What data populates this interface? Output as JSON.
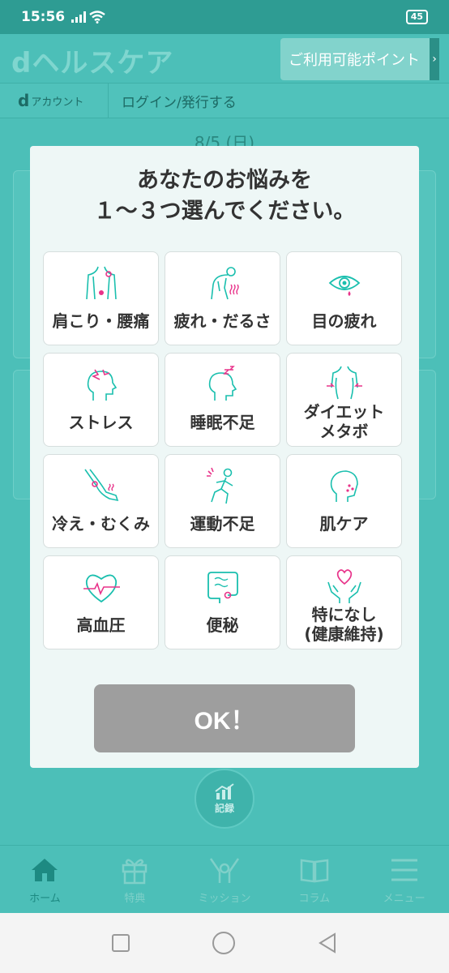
{
  "status": {
    "time": "15:56",
    "battery": "45"
  },
  "header": {
    "logo": "dヘルスケア",
    "points_button": "ご利用可能ポイント"
  },
  "account": {
    "label_prefix": "d",
    "label": "アカウント",
    "login": "ログイン/発行する"
  },
  "background": {
    "date": "8/5 (日)"
  },
  "modal": {
    "title_line1": "あなたのお悩みを",
    "title_line2": "１～３つ選んでください。",
    "options": [
      {
        "label": "肩こり・腰痛",
        "icon": "shoulder-back-pain-icon"
      },
      {
        "label": "疲れ・だるさ",
        "icon": "fatigue-icon"
      },
      {
        "label": "目の疲れ",
        "icon": "eye-strain-icon"
      },
      {
        "label": "ストレス",
        "icon": "stress-icon"
      },
      {
        "label": "睡眠不足",
        "icon": "sleep-icon"
      },
      {
        "label": "ダイエット\nメタボ",
        "icon": "diet-icon"
      },
      {
        "label": "冷え・むくみ",
        "icon": "cold-swelling-icon"
      },
      {
        "label": "運動不足",
        "icon": "running-icon"
      },
      {
        "label": "肌ケア",
        "icon": "skin-care-icon"
      },
      {
        "label": "高血圧",
        "icon": "heart-pulse-icon"
      },
      {
        "label": "便秘",
        "icon": "intestine-icon"
      },
      {
        "label": "特になし\n(健康維持)",
        "icon": "hands-heart-icon"
      }
    ],
    "ok_button": "OK！"
  },
  "record_button": "記録",
  "bottom_nav": [
    {
      "label": "ホーム",
      "icon": "home-icon",
      "active": true
    },
    {
      "label": "特典",
      "icon": "gift-icon",
      "active": false
    },
    {
      "label": "ミッション",
      "icon": "mission-icon",
      "active": false
    },
    {
      "label": "コラム",
      "icon": "book-icon",
      "active": false
    },
    {
      "label": "メニュー",
      "icon": "menu-icon",
      "active": false
    }
  ],
  "colors": {
    "teal": "#4cbfb8",
    "accent": "#1abfae",
    "pink": "#e8338a",
    "ok_disabled": "#9e9e9e"
  }
}
